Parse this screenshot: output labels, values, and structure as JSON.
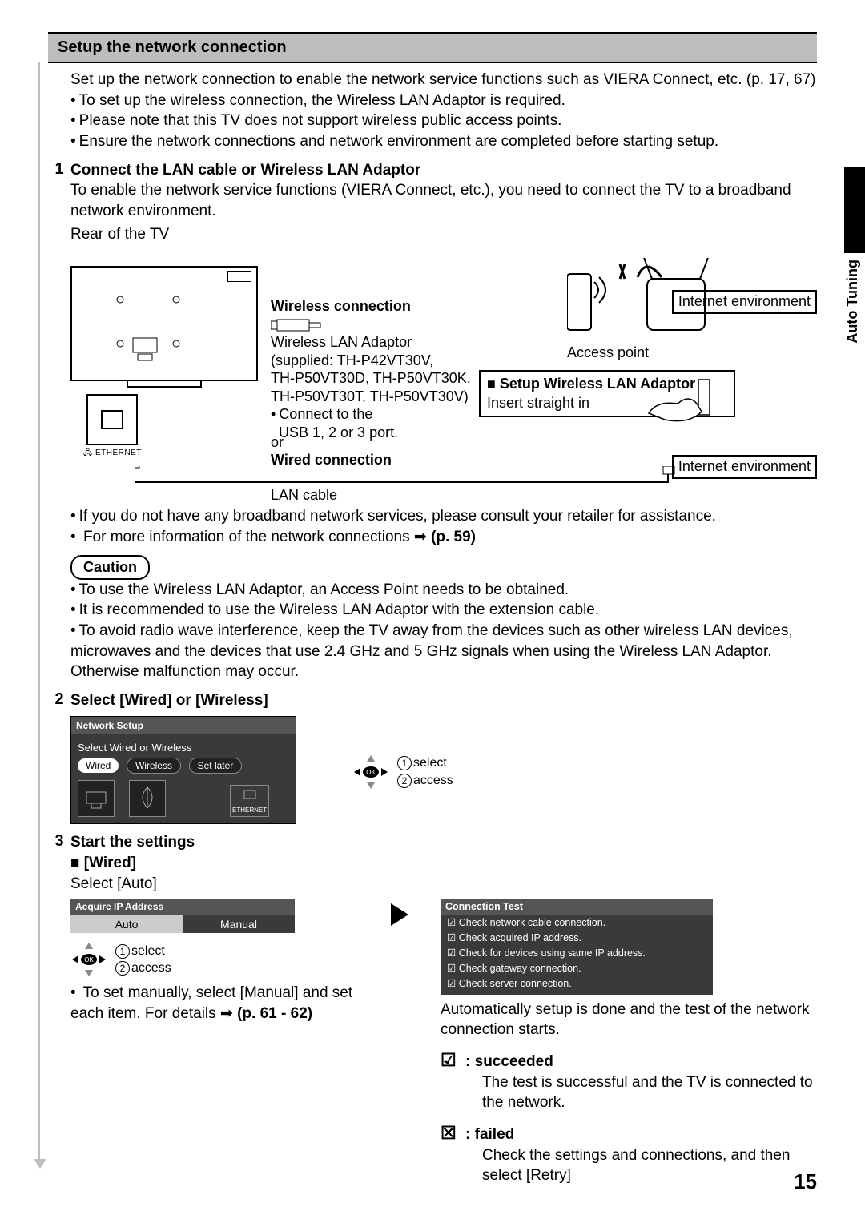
{
  "section_title": "Setup the network connection",
  "intro_line1": "Set up the network connection to enable the network service functions such as VIERA Connect, etc. (p. 17, 67)",
  "intro_b1": "To set up the wireless connection, the Wireless LAN Adaptor is required.",
  "intro_b2": "Please note that this TV does not support wireless public access points.",
  "intro_b3": "Ensure the network connections and network environment are completed before starting setup.",
  "step1": {
    "num": "1",
    "title": "Connect the LAN cable or Wireless LAN Adaptor",
    "desc": "To enable the network service functions (VIERA Connect, etc.), you need to connect the TV to a broadband network environment.",
    "rear_label": "Rear of the TV",
    "ethernet_label": "ETHERNET",
    "wireless_title": "Wireless connection",
    "wlan_adaptor_line1": "Wireless LAN Adaptor",
    "wlan_adaptor_line2": "(supplied: TH-P42VT30V,",
    "wlan_adaptor_line3": "TH-P50VT30D, TH-P50VT30K,",
    "wlan_adaptor_line4": "TH-P50VT30T, TH-P50VT30V)",
    "wlan_connect_b": "Connect to the",
    "wlan_connect_b2": "USB 1, 2 or 3 port.",
    "or_label": "or",
    "wired_title": "Wired connection",
    "lan_cable": "LAN cable",
    "access_point": "Access point",
    "setup_wlan_title": "Setup Wireless LAN Adaptor",
    "setup_wlan_insert": "Insert straight in",
    "internet_env": "Internet environment",
    "after_b1": "If you do not have any broadband network services, please consult your retailer for assistance.",
    "after_b2_pre": "For more information of the network connections ",
    "after_b2_ref": "(p. 59)",
    "caution_label": "Caution",
    "caution_b1": "To use the Wireless LAN Adaptor, an Access Point needs to be obtained.",
    "caution_b2": "It is recommended to use the Wireless LAN Adaptor with the extension cable.",
    "caution_b3": "To avoid radio wave interference, keep the TV away from the devices such as other wireless LAN devices, microwaves and the devices that use 2.4 GHz and 5 GHz signals when using the Wireless LAN Adaptor.",
    "caution_b3b": "Otherwise malfunction may occur."
  },
  "step2": {
    "num": "2",
    "title": "Select [Wired] or [Wireless]",
    "osd_title": "Network Setup",
    "osd_prompt": "Select Wired or Wireless",
    "btn_wired": "Wired",
    "btn_wireless": "Wireless",
    "btn_setlater": "Set later",
    "eth_icon_label": "ETHERNET",
    "nav_select": "select",
    "nav_access": "access"
  },
  "step3": {
    "num": "3",
    "title": "Start the settings",
    "wired_label": "[Wired]",
    "select_auto": "Select [Auto]",
    "ip_title": "Acquire IP Address",
    "ip_auto": "Auto",
    "ip_manual": "Manual",
    "nav_select": "select",
    "nav_access": "access",
    "manual_note_pre": "To set manually, select [Manual] and set each item. For details ",
    "manual_note_ref": "(p. 61 - 62)",
    "conn_title": "Connection Test",
    "conn_items": [
      "Check network cable connection.",
      "Check acquired IP address.",
      "Check for devices using same IP address.",
      "Check gateway connection.",
      "Check server connection."
    ],
    "auto_done": "Automatically setup is done and the test of the network connection starts.",
    "succeeded_label": ": succeeded",
    "succeeded_desc": "The test is successful and the TV is connected to the network.",
    "failed_label": ": failed",
    "failed_desc": "Check the settings and connections, and then select [Retry]"
  },
  "side_tab": "Auto Tuning",
  "page_number": "15"
}
